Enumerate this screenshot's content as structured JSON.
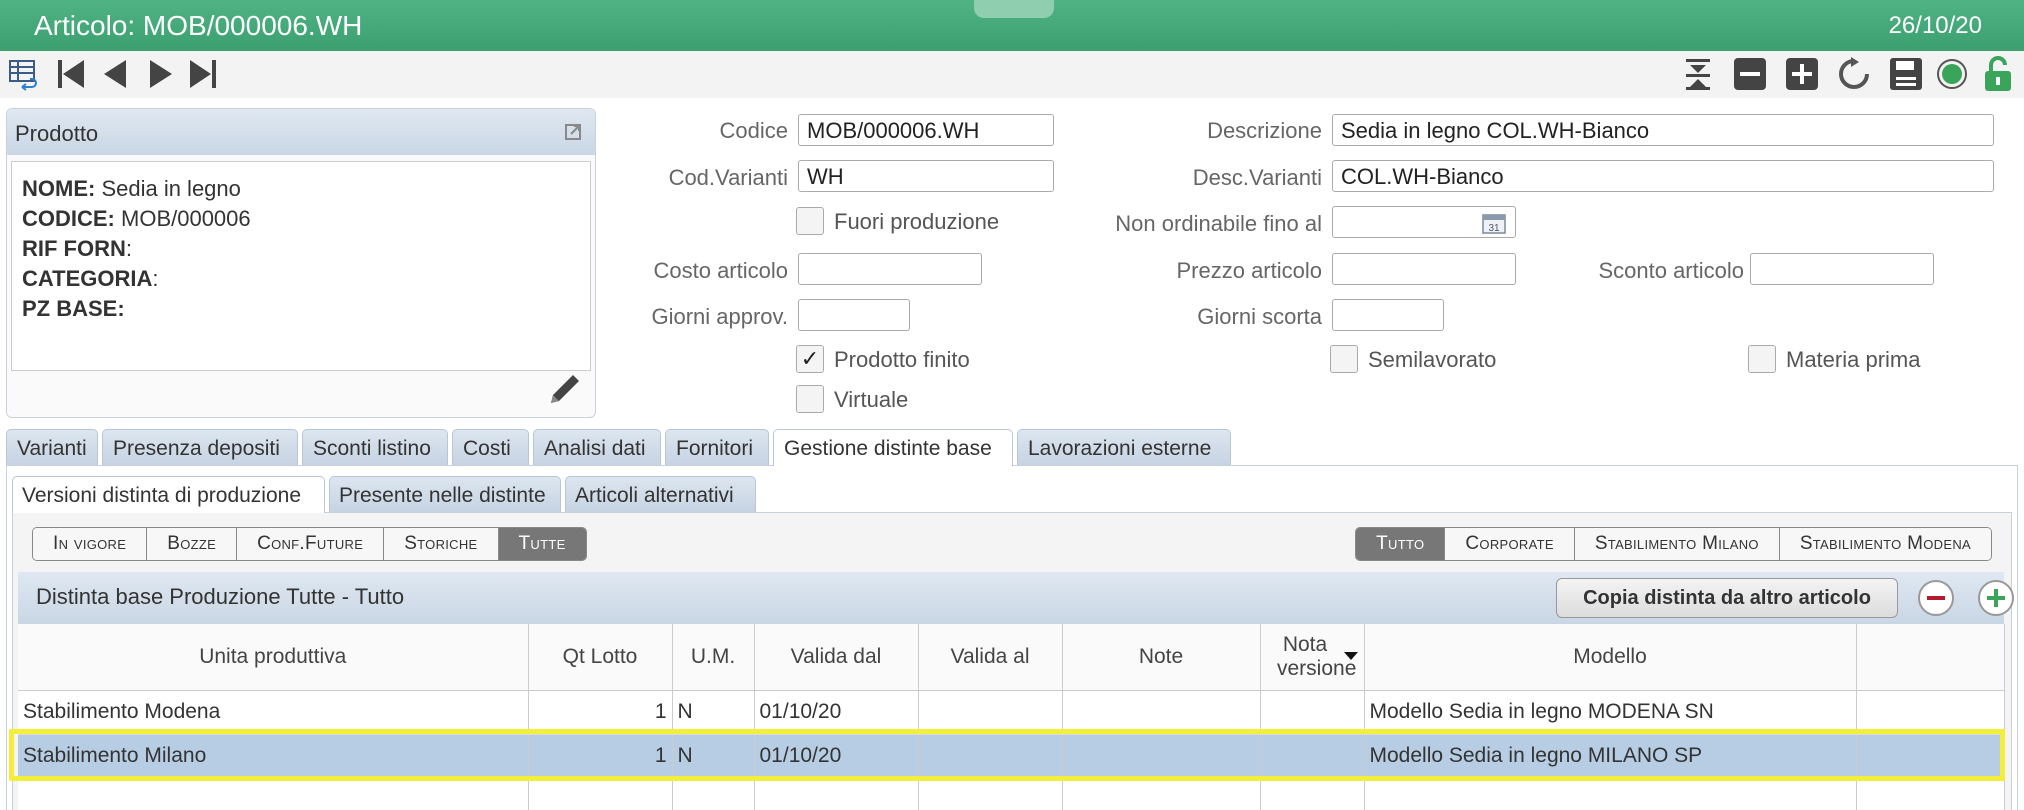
{
  "window": {
    "title": "Articolo: MOB/000006.WH",
    "date": "26/10/20"
  },
  "product": {
    "header": "Prodotto",
    "lines": [
      {
        "label": "NOME:",
        "value": " Sedia in legno"
      },
      {
        "label": "CODICE:",
        "value": " MOB/000006"
      },
      {
        "label": "RIF FORN",
        "value": ":"
      },
      {
        "label": "CATEGORIA",
        "value": ":"
      },
      {
        "label": "PZ BASE:",
        "value": ""
      }
    ]
  },
  "form": {
    "codice_label": "Codice",
    "codice_value": "MOB/000006.WH",
    "descrizione_label": "Descrizione",
    "descrizione_value": "Sedia in legno COL.WH-Bianco",
    "cod_varianti_label": "Cod.Varianti",
    "cod_varianti_value": "WH",
    "desc_varianti_label": "Desc.Varianti",
    "desc_varianti_value": "COL.WH-Bianco",
    "fuori_produzione_label": "Fuori produzione",
    "non_ordinabile_label": "Non ordinabile fino al",
    "costo_label": "Costo articolo",
    "prezzo_label": "Prezzo articolo",
    "sconto_label": "Sconto articolo",
    "giorni_approv_label": "Giorni approv.",
    "giorni_scorta_label": "Giorni scorta",
    "prodotto_finito_label": "Prodotto finito",
    "semilavorato_label": "Semilavorato",
    "materia_prima_label": "Materia prima",
    "virtuale_label": "Virtuale",
    "check_mark": "✓"
  },
  "tabs": [
    "Varianti",
    "Presenza depositi",
    "Sconti listino",
    "Costi",
    "Analisi dati",
    "Fornitori",
    "Gestione distinte base",
    "Lavorazioni esterne"
  ],
  "subtabs": [
    "Versioni distinta di produzione",
    "Presente nelle distinte",
    "Articoli alternativi"
  ],
  "filters_left": [
    "In vigore",
    "Bozze",
    "Conf.Future",
    "Storiche",
    "Tutte"
  ],
  "filters_right": [
    "Tutto",
    "Corporate",
    "Stabilimento Milano",
    "Stabilimento Modena"
  ],
  "grid": {
    "title": "Distinta base Produzione Tutte - Tutto",
    "copy_button": "Copia distinta da altro articolo",
    "columns": [
      "Unita produttiva",
      "Qt Lotto",
      "U.M.",
      "Valida dal",
      "Valida al",
      "Note",
      "Nota versione",
      "Modello",
      ""
    ],
    "rows": [
      [
        "Stabilimento Modena",
        "1",
        "N",
        "01/10/20",
        "",
        "",
        "",
        "Modello Sedia in legno MODENA SN",
        ""
      ],
      [
        "Stabilimento Milano",
        "1",
        "N",
        "01/10/20",
        "",
        "",
        "",
        "Modello Sedia in legno MILANO SP",
        ""
      ]
    ],
    "selected_row": 1
  },
  "colors": {
    "title_green": "#45a979",
    "selected_row": "#b7cde4",
    "highlight": "#f3ee3a"
  }
}
